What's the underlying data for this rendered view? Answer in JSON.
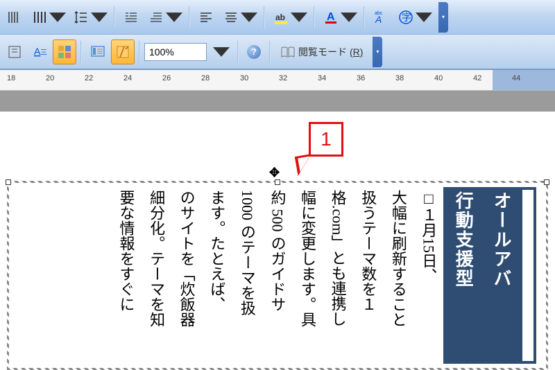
{
  "toolbar": {
    "zoom_value": "100%",
    "reading_mode_label": "閲覧モード",
    "reading_mode_accel": "(R)"
  },
  "ruler": {
    "ticks": [
      18,
      20,
      22,
      24,
      26,
      28,
      30,
      32,
      34,
      36,
      38,
      40,
      42,
      44
    ]
  },
  "callout": {
    "number": "1"
  },
  "document": {
    "title_line1": "オールアバ",
    "title_line2": "行動支援型",
    "body_columns": [
      "□１月15日、",
      "大幅に刷新すること",
      "扱うテーマ数を１",
      "格.com」とも連携し",
      "幅に変更します。具",
      "約 500 のガイドサ",
      "1000 のテーマを扱",
      "ます。たとえば、",
      "のサイトを「炊飯器",
      "細分化。テーマを知",
      "要な情報をすぐに"
    ]
  }
}
